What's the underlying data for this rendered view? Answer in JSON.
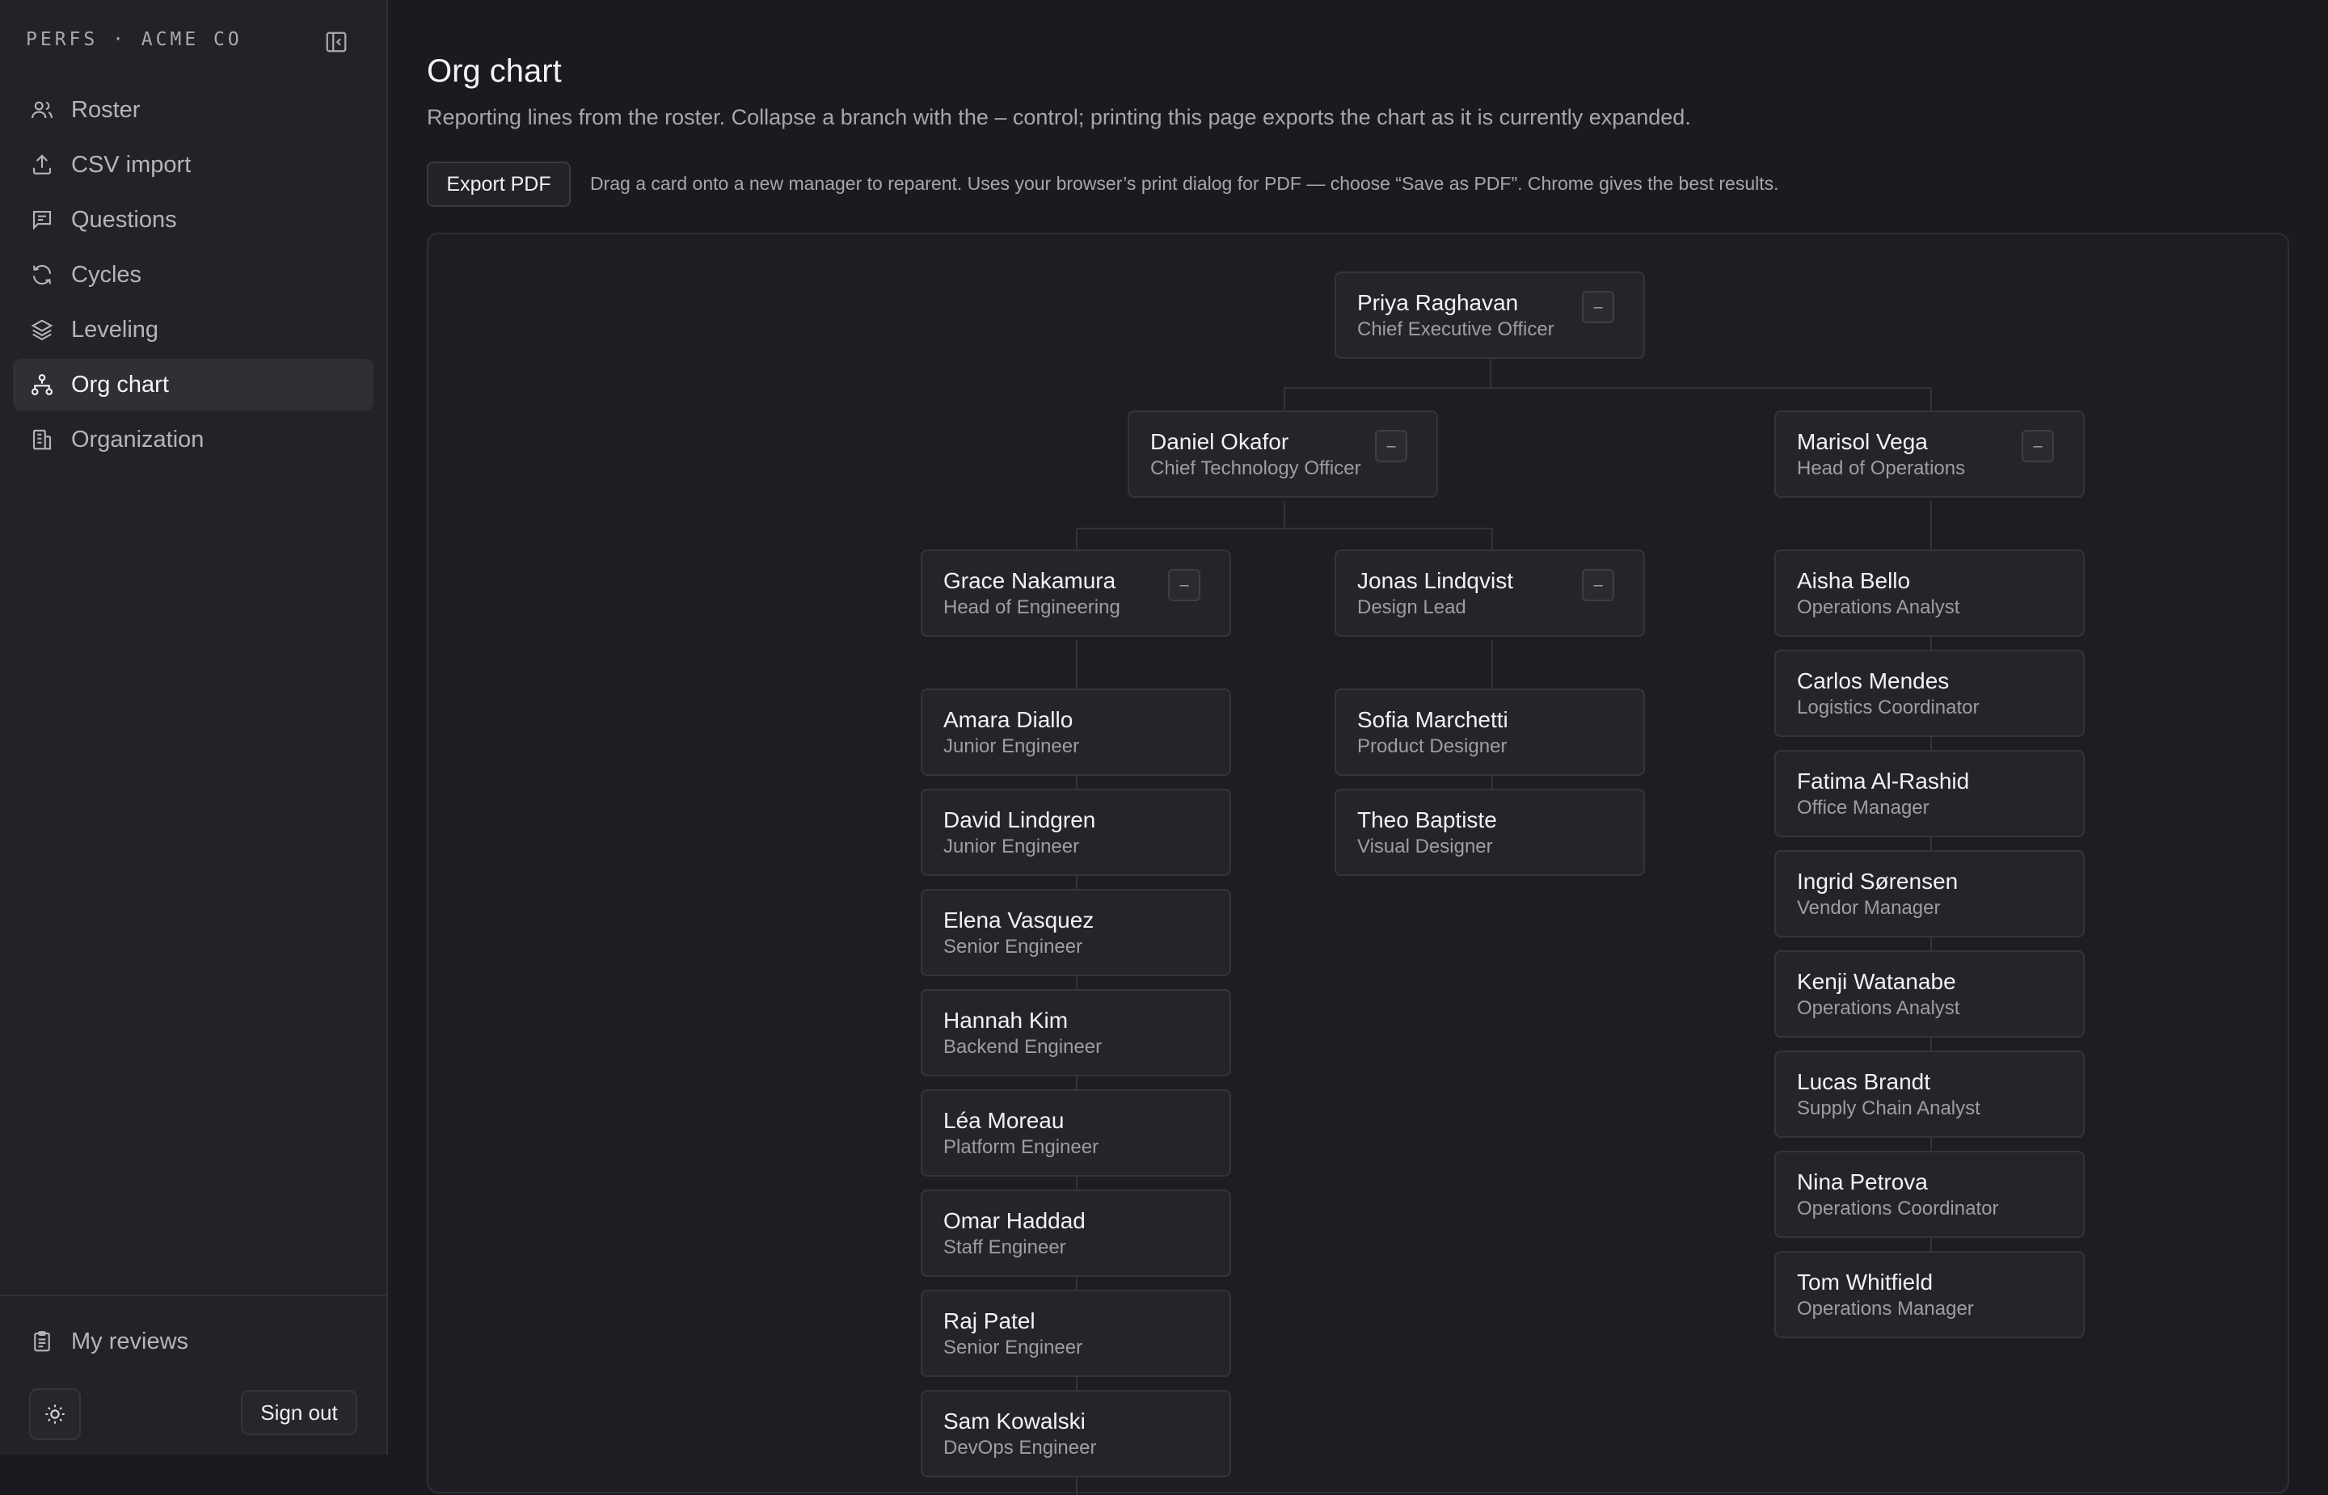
{
  "sidebar": {
    "brand": "PERFS · ACME CO",
    "nav": [
      {
        "label": "Roster",
        "icon": "users-icon"
      },
      {
        "label": "CSV import",
        "icon": "upload-icon"
      },
      {
        "label": "Questions",
        "icon": "message-square-icon"
      },
      {
        "label": "Cycles",
        "icon": "refresh-icon"
      },
      {
        "label": "Leveling",
        "icon": "layers-icon"
      },
      {
        "label": "Org chart",
        "icon": "org-chart-icon",
        "active": true
      },
      {
        "label": "Organization",
        "icon": "building-icon"
      }
    ],
    "my_reviews": "My reviews",
    "sign_out": "Sign out"
  },
  "main": {
    "title": "Org chart",
    "subtitle": "Reporting lines from the roster. Collapse a branch with the – control; printing this page exports the chart as it is currently expanded.",
    "export_label": "Export PDF",
    "export_hint": "Drag a card onto a new manager to reparent. Uses your browser’s print dialog for PDF — choose “Save as PDF”. Chrome gives the best results."
  },
  "org": {
    "collapse_glyph": "–",
    "people": {
      "priya": {
        "name": "Priya Raghavan",
        "role": "Chief Executive Officer"
      },
      "daniel": {
        "name": "Daniel Okafor",
        "role": "Chief Technology Officer"
      },
      "marisol": {
        "name": "Marisol Vega",
        "role": "Head of Operations"
      },
      "grace": {
        "name": "Grace Nakamura",
        "role": "Head of Engineering"
      },
      "jonas": {
        "name": "Jonas Lindqvist",
        "role": "Design Lead"
      },
      "amara": {
        "name": "Amara Diallo",
        "role": "Junior Engineer"
      },
      "david": {
        "name": "David Lindgren",
        "role": "Junior Engineer"
      },
      "elena": {
        "name": "Elena Vasquez",
        "role": "Senior Engineer"
      },
      "hannah": {
        "name": "Hannah Kim",
        "role": "Backend Engineer"
      },
      "lea": {
        "name": "Léa Moreau",
        "role": "Platform Engineer"
      },
      "omar": {
        "name": "Omar Haddad",
        "role": "Staff Engineer"
      },
      "raj": {
        "name": "Raj Patel",
        "role": "Senior Engineer"
      },
      "sam": {
        "name": "Sam Kowalski",
        "role": "DevOps Engineer"
      },
      "sofia": {
        "name": "Sofia Marchetti",
        "role": "Product Designer"
      },
      "theo": {
        "name": "Theo Baptiste",
        "role": "Visual Designer"
      },
      "aisha": {
        "name": "Aisha Bello",
        "role": "Operations Analyst"
      },
      "carlos": {
        "name": "Carlos Mendes",
        "role": "Logistics Coordinator"
      },
      "fatima": {
        "name": "Fatima Al-Rashid",
        "role": "Office Manager"
      },
      "ingrid": {
        "name": "Ingrid Sørensen",
        "role": "Vendor Manager"
      },
      "kenji": {
        "name": "Kenji Watanabe",
        "role": "Operations Analyst"
      },
      "lucas": {
        "name": "Lucas Brandt",
        "role": "Supply Chain Analyst"
      },
      "nina": {
        "name": "Nina Petrova",
        "role": "Operations Coordinator"
      },
      "tom": {
        "name": "Tom Whitfield",
        "role": "Operations Manager"
      }
    }
  }
}
